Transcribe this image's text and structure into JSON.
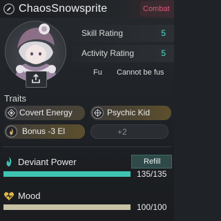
{
  "header": {
    "name": "ChaosSnowsprite",
    "combat_tab": "Combat",
    "edit_icon": "pencil-icon"
  },
  "avatar": {
    "share_icon": "share-upload-icon"
  },
  "stats": {
    "skill_rating": {
      "label": "Skill Rating",
      "value": "5"
    },
    "activity_rating": {
      "label": "Activity Rating",
      "value": "5"
    },
    "fuse": {
      "key": "Fu",
      "text": "Cannot be fus"
    }
  },
  "traits": {
    "title": "Traits",
    "items": [
      {
        "label": "Covert Energy",
        "icon": "diamond-icon"
      },
      {
        "label": "Psychic Kid",
        "icon": "crosshair-icon"
      },
      {
        "label": "Bonus -3   El",
        "icon": "flame-icon"
      }
    ],
    "more": "+2"
  },
  "deviant_power": {
    "label": "Deviant Power",
    "refill": "Refill",
    "value_text": "135/135",
    "fill": 1.0,
    "color": "#3fc4b4",
    "icon": "flame-icon"
  },
  "mood": {
    "label": "Mood",
    "value_text": "100/100",
    "fill": 1.0,
    "color": "#c9c3a6",
    "icon": "heart-icon"
  },
  "colors": {
    "accent_teal": "#46e0d0",
    "combat_pink": "#e0567a",
    "trait_gold": "#b89a4a"
  }
}
